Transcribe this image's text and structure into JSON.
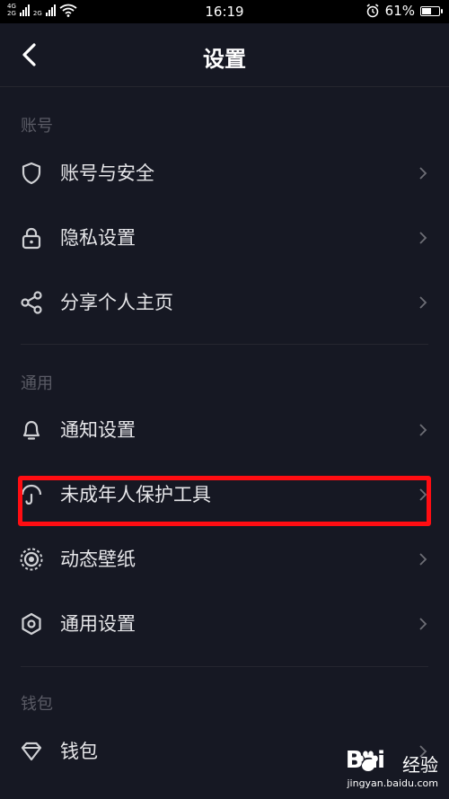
{
  "status_bar": {
    "network_top": "4G",
    "network_bottom": "2G",
    "network2_top": "",
    "network2_bottom": "2G",
    "time": "16:19",
    "battery": "61%",
    "battery_level": 0.61
  },
  "header": {
    "title": "设置"
  },
  "sections": {
    "account": {
      "title": "账号",
      "items": [
        {
          "label": "账号与安全",
          "icon": "shield-icon"
        },
        {
          "label": "隐私设置",
          "icon": "lock-icon"
        },
        {
          "label": "分享个人主页",
          "icon": "share-icon"
        }
      ]
    },
    "general": {
      "title": "通用",
      "items": [
        {
          "label": "通知设置",
          "icon": "bell-icon"
        },
        {
          "label": "未成年人保护工具",
          "icon": "umbrella-icon"
        },
        {
          "label": "动态壁纸",
          "icon": "live-wallpaper-icon"
        },
        {
          "label": "通用设置",
          "icon": "hexagon-settings-icon"
        }
      ]
    },
    "wallet": {
      "title": "钱包",
      "items": [
        {
          "label": "钱包",
          "icon": "diamond-icon"
        }
      ]
    }
  },
  "colors": {
    "background": "#161823",
    "highlight": "#ff0d12",
    "section_title": "#5a5b65"
  },
  "watermark": {
    "brand": "Bai",
    "brand_suffix": "",
    "product": "经验",
    "url": "jingyan.baidu.com"
  }
}
